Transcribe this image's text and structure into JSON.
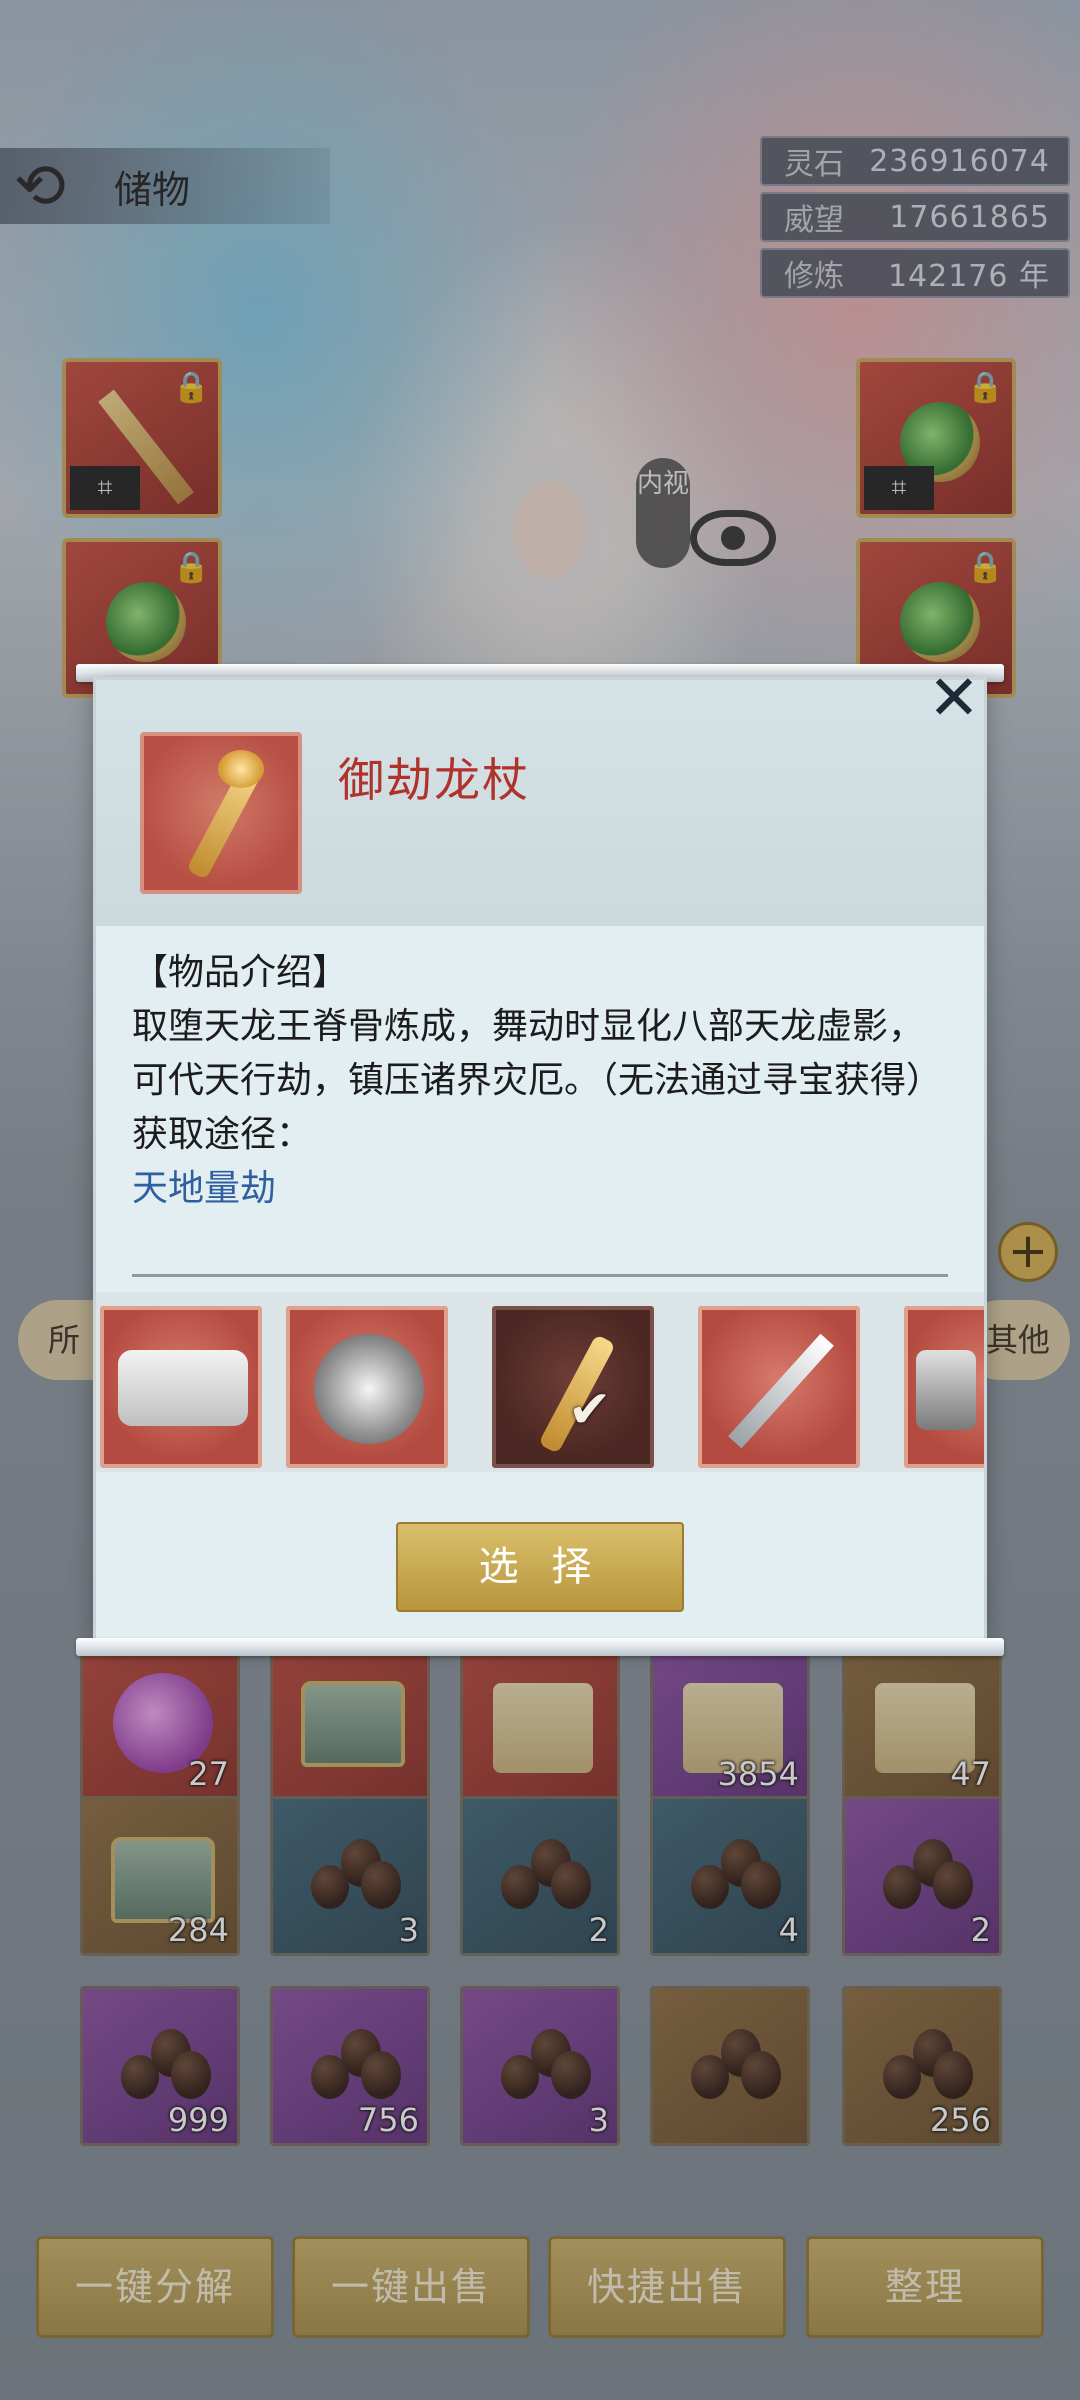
{
  "header": {
    "title": "储物",
    "resources": [
      {
        "label": "灵石",
        "value": "236916074"
      },
      {
        "label": "威望",
        "value": "17661865"
      },
      {
        "label": "修炼",
        "value": "142176 年"
      }
    ]
  },
  "character": {
    "inner_view_label": "内视"
  },
  "tabs": {
    "left_label": "所",
    "right_label": "其他"
  },
  "inventory": {
    "rows": [
      [
        {
          "color": "red",
          "icon": "gem-blob",
          "count": "27"
        },
        {
          "color": "red",
          "icon": "chest",
          "count": ""
        },
        {
          "color": "red",
          "icon": "armor",
          "count": ""
        },
        {
          "color": "purple",
          "icon": "scroll",
          "count": "3854"
        },
        {
          "color": "brown",
          "icon": "scroll",
          "count": "47"
        }
      ],
      [
        {
          "color": "brown",
          "icon": "chest",
          "count": "284"
        },
        {
          "color": "blue",
          "icon": "seeds",
          "count": "3"
        },
        {
          "color": "blue",
          "icon": "seeds",
          "count": "2"
        },
        {
          "color": "blue",
          "icon": "seeds",
          "count": "4"
        },
        {
          "color": "purple",
          "icon": "seeds",
          "count": "2"
        }
      ],
      [
        {
          "color": "purple",
          "icon": "seeds",
          "count": "999"
        },
        {
          "color": "purple",
          "icon": "seeds",
          "count": "756"
        },
        {
          "color": "purple",
          "icon": "seeds",
          "count": "3"
        },
        {
          "color": "brown",
          "icon": "seeds",
          "count": ""
        },
        {
          "color": "brown",
          "icon": "seeds",
          "count": "256"
        }
      ]
    ]
  },
  "bottom_actions": [
    "一键分解",
    "一键出售",
    "快捷出售",
    "整理"
  ],
  "modal": {
    "item_name": "御劫龙杖",
    "desc_heading": "【物品介绍】",
    "desc_text": "取堕天龙王脊骨炼成，舞动时显化八部天龙虚影，可代天行劫，镇压诸界灾厄。（无法通过寻宝获得）",
    "source_heading": "获取途径：",
    "source_value": "天地量劫",
    "choices": [
      "scroll",
      "silver-disc",
      "dragon-staff",
      "sakura-sword",
      "claw"
    ],
    "selected_index": 2,
    "select_label": "选 择",
    "close_glyph": "✕"
  }
}
